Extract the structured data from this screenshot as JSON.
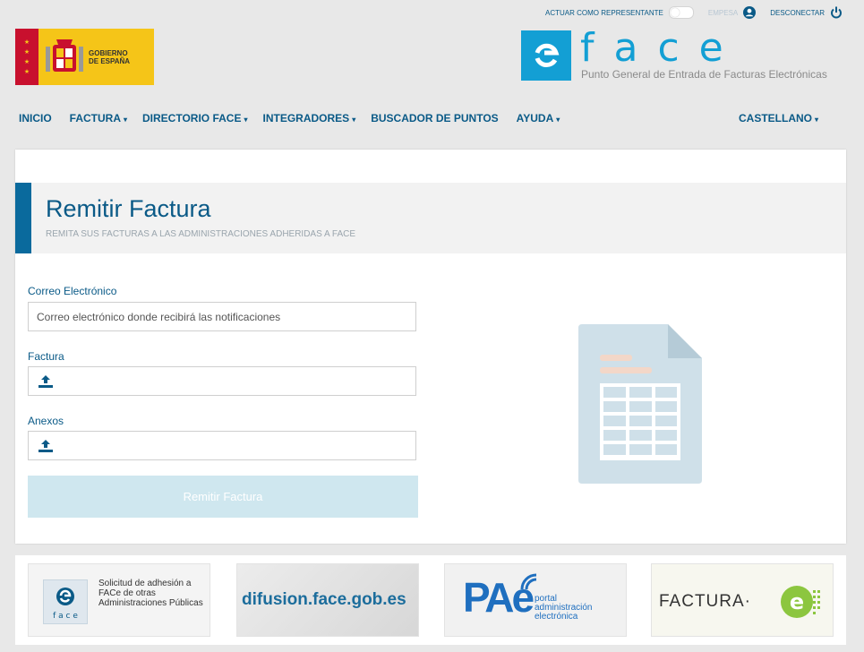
{
  "topbar": {
    "representative_label": "ACTUAR COMO REPRESENTANTE",
    "company_label": "EMPESA",
    "disconnect_label": "DESCONECTAR"
  },
  "gobierno_logo": {
    "text": "GOBIERNO DE ESPAÑA"
  },
  "face_logo": {
    "letters": "face",
    "subtitle": "Punto General de Entrada de Facturas Electrónicas"
  },
  "nav": {
    "items": [
      {
        "label": "INICIO",
        "caret": ""
      },
      {
        "label": "FACTURA",
        "caret": "▾"
      },
      {
        "label": "DIRECTORIO FACE",
        "caret": "▾"
      },
      {
        "label": "INTEGRADORES",
        "caret": "▾"
      },
      {
        "label": "BUSCADOR DE PUNTOS",
        "caret": ""
      },
      {
        "label": "AYUDA",
        "caret": "▾"
      }
    ],
    "language": "CASTELLANO",
    "language_caret": "▾"
  },
  "page": {
    "title": "Remitir Factura",
    "subtitle": "REMITA SUS FACTURAS A LAS ADMINISTRACIONES ADHERIDAS A FACE"
  },
  "form": {
    "email_label": "Correo Electrónico",
    "email_placeholder": "Correo electrónico donde recibirá las notificaciones",
    "invoice_label": "Factura",
    "attachments_label": "Anexos",
    "submit_label": "Remitir Factura"
  },
  "banners": {
    "adhesion_text": "Solicitud de adhesión a FACe de otras Administraciones Públicas",
    "difusion_text": "difusion.face.gob.es",
    "pae_text": "PAe",
    "pae_subtext": "portal administración electrónica",
    "factura_text": "FACTURA·"
  },
  "colors": {
    "accent": "#0a5a87",
    "brand_blue": "#139fd4",
    "submit_disabled": "#cfe7ef",
    "gob_yellow": "#f5c518",
    "gob_red": "#c8102e"
  },
  "icons": {
    "toggle": "toggle-switch",
    "user": "user-circle-icon",
    "power": "power-icon",
    "upload": "upload-icon",
    "document": "invoice-document-icon"
  }
}
